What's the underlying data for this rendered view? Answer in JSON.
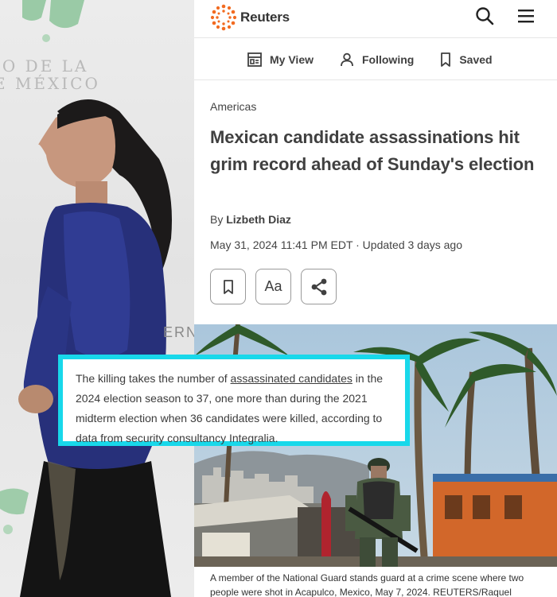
{
  "background_photo": {
    "banner_text": "IO DE LA\nE MÉXICO",
    "podium_text": "ERN"
  },
  "app": {
    "brand_name": "Reuters",
    "icons": {
      "search": "search-icon",
      "menu": "hamburger-menu-icon"
    }
  },
  "subnav": {
    "items": [
      {
        "label": "My View",
        "icon": "my-view-icon"
      },
      {
        "label": "Following",
        "icon": "person-icon"
      },
      {
        "label": "Saved",
        "icon": "bookmark-icon"
      }
    ]
  },
  "article": {
    "section": "Americas",
    "headline": "Mexican candidate assassinations hit grim record ahead of Sunday's election",
    "byline_prefix": "By ",
    "author": "Lizbeth Diaz",
    "dateline": "May 31, 2024 11:41 PM EDT · Updated 3 days ago",
    "actions": {
      "save": "bookmark-icon",
      "text_size_label": "Aa",
      "share": "share-icon"
    },
    "image_caption": "A member of the National Guard stands guard at a crime scene where two people were shot in Acapulco, Mexico, May 7, 2024. REUTERS/Raquel"
  },
  "highlight_quote": {
    "before_link": "The killing takes the number of ",
    "link_text": "assassinated candidates",
    "after_link": " in the 2024 election season to 37, one more than during the 2021 midterm election when 36 candidates were killed, according to data from security consultancy Integralia."
  },
  "colors": {
    "highlight_border": "#18d8ea",
    "reuters_orange": "#f26b21",
    "text_dark": "#404040"
  }
}
